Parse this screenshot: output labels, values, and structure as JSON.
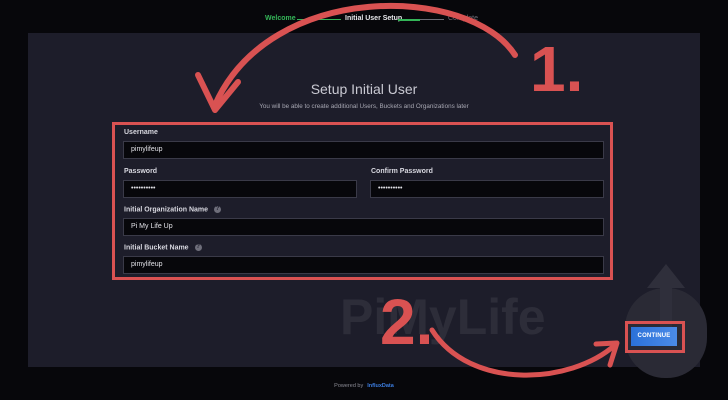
{
  "steps": {
    "welcome": "Welcome",
    "initial_setup": "Initial User Setup",
    "complete": "Complete"
  },
  "form": {
    "title": "Setup Initial User",
    "subtitle": "You will be able to create additional Users, Buckets and Organizations later",
    "username_label": "Username",
    "username_value": "pimylifeup",
    "password_label": "Password",
    "password_value": "••••••••••",
    "confirm_password_label": "Confirm Password",
    "confirm_password_value": "••••••••••",
    "org_label": "Initial Organization Name",
    "org_value": "Pi My Life Up",
    "bucket_label": "Initial Bucket Name",
    "bucket_value": "pimylifeup"
  },
  "continue_label": "CONTINUE",
  "footer": {
    "powered_by": "Powered by",
    "brand": "InfluxData"
  },
  "annotations": {
    "step_one": "1.",
    "step_two": "2."
  },
  "watermark": "PiMyLife",
  "colors": {
    "accent_green": "#34b558",
    "annotation_red": "#d95252",
    "button_blue": "#2b71d8",
    "panel_bg": "#1d1d2a"
  }
}
